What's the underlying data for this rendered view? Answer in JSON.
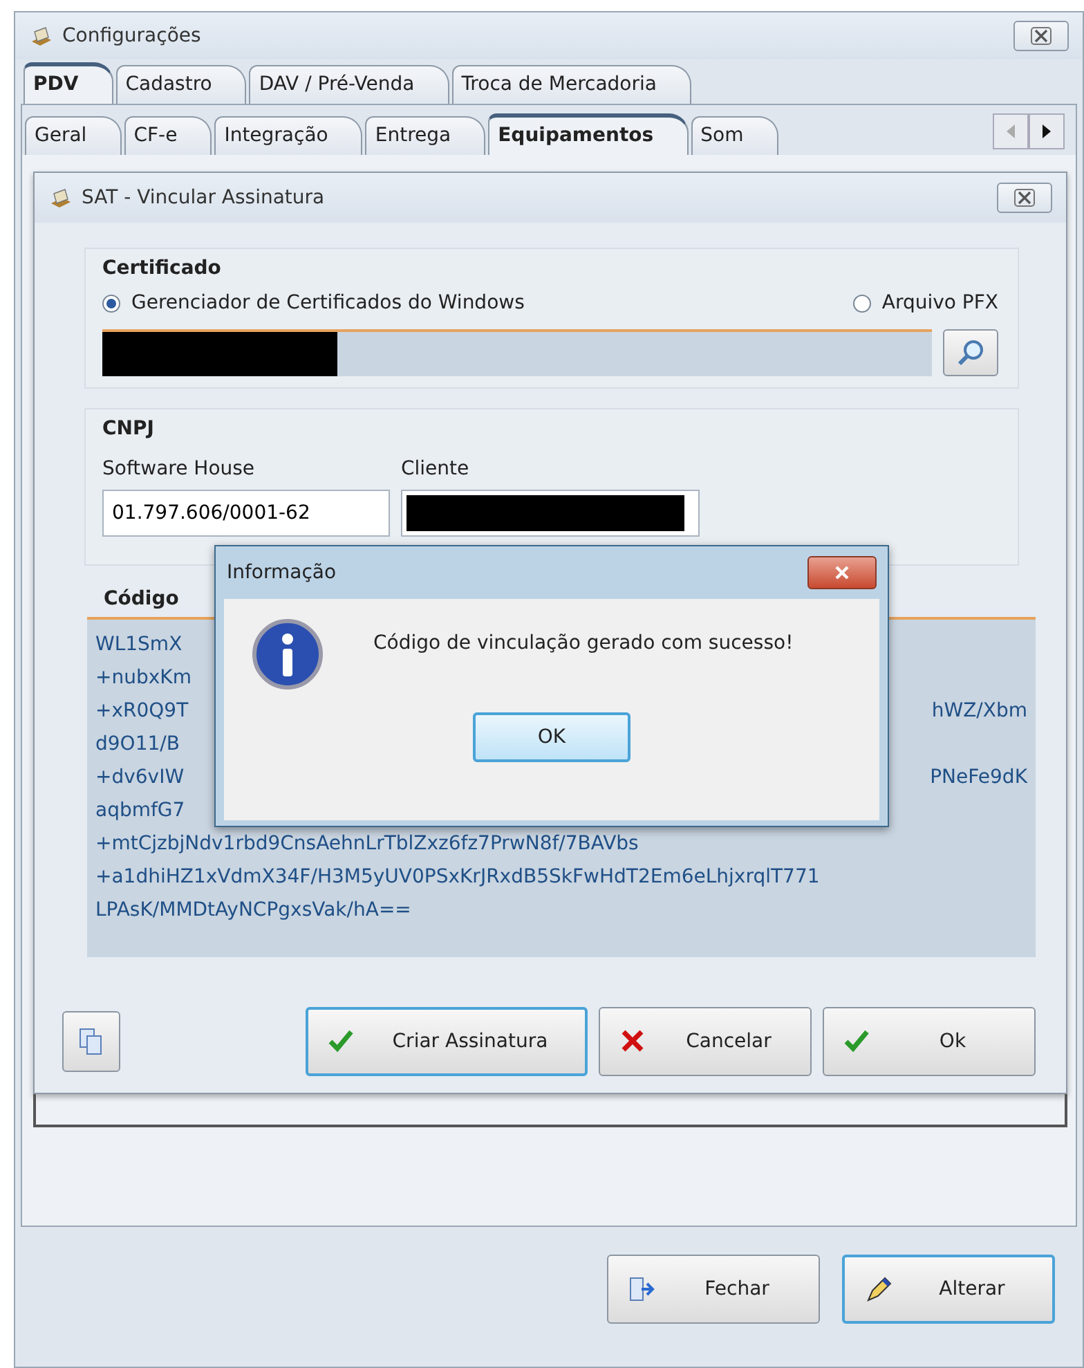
{
  "window": {
    "title": "Configurações"
  },
  "tabs": [
    {
      "label": "PDV",
      "selected": true
    },
    {
      "label": "Cadastro",
      "selected": false
    },
    {
      "label": "DAV / Pré-Venda",
      "selected": false
    },
    {
      "label": "Troca de Mercadoria",
      "selected": false
    }
  ],
  "subtabs": [
    {
      "label": "Geral",
      "selected": false
    },
    {
      "label": "CF-e",
      "selected": false
    },
    {
      "label": "Integração",
      "selected": false
    },
    {
      "label": "Entrega",
      "selected": false
    },
    {
      "label": "Equipamentos",
      "selected": true
    },
    {
      "label": "Som",
      "selected": false
    }
  ],
  "dialog": {
    "title": "SAT - Vincular Assinatura",
    "certificado": {
      "title": "Certificado",
      "options": [
        {
          "label": "Gerenciador de Certificados do Windows",
          "selected": true
        },
        {
          "label": "Arquivo PFX",
          "selected": false
        }
      ]
    },
    "cnpj": {
      "title": "CNPJ",
      "software_house": {
        "label": "Software House",
        "value": "01.797.606/0001-62"
      },
      "cliente": {
        "label": "Cliente"
      }
    },
    "codigo": {
      "title": "Código",
      "lines": [
        {
          "left": "WL1SmX"
        },
        {
          "left": "+nubxKm"
        },
        {
          "left": "+xR0Q9T",
          "right": "hWZ/Xbm"
        },
        {
          "left": "d9O11/B"
        },
        {
          "left": "+dv6vIW",
          "right": "PNeFe9dK"
        },
        {
          "left": "aqbmfG7"
        },
        {
          "left": "+mtCjzbjNdv1rbd9CnsAehnLrTblZxz6fz7PrwN8f/7BAVbs"
        },
        {
          "left": "+a1dhiHZ1xVdmX34F/H3M5yUV0PSxKrJRxdB5SkFwHdT2Em6eLhjxrqlT771"
        },
        {
          "left": "LPAsK/MMDtAyNCPgxsVak/hA=="
        }
      ]
    },
    "buttons": [
      {
        "label": "Criar Assinatura",
        "kind": "check",
        "focused": true
      },
      {
        "label": "Cancelar",
        "kind": "cross",
        "focused": false
      },
      {
        "label": "Ok",
        "kind": "check",
        "focused": false
      }
    ]
  },
  "message": {
    "title": "Informação",
    "text": "Código de vinculação gerado com sucesso!",
    "button": "OK"
  },
  "footer_buttons": [
    {
      "label": "Fechar",
      "kind": "exit",
      "focused": false
    },
    {
      "label": "Alterar",
      "kind": "edit",
      "focused": true
    }
  ]
}
